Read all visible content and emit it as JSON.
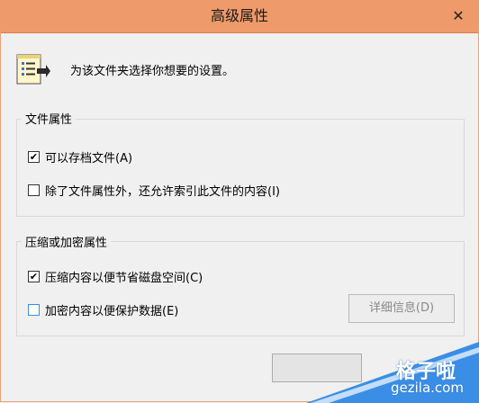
{
  "window": {
    "title": "高级属性",
    "close_glyph": "✕",
    "accent": "#ef9a6a"
  },
  "header": {
    "icon": "file-properties-icon",
    "text": "为该文件夹选择你想要的设置。"
  },
  "groups": [
    {
      "legend": "文件属性",
      "options": [
        {
          "label": "可以存档文件(A)",
          "checked": true
        },
        {
          "label": "除了文件属性外，还允许索引此文件的内容(I)",
          "checked": false
        }
      ]
    },
    {
      "legend": "压缩或加密属性",
      "options": [
        {
          "label": "压缩内容以便节省磁盘空间(C)",
          "checked": true
        },
        {
          "label": "加密内容以便保护数据(E)",
          "checked": false
        }
      ],
      "details_button": "详细信息(D)"
    }
  ],
  "watermark": {
    "line1": "格子啦",
    "line2": "gezila.com",
    "color": "#3a8ee6"
  }
}
